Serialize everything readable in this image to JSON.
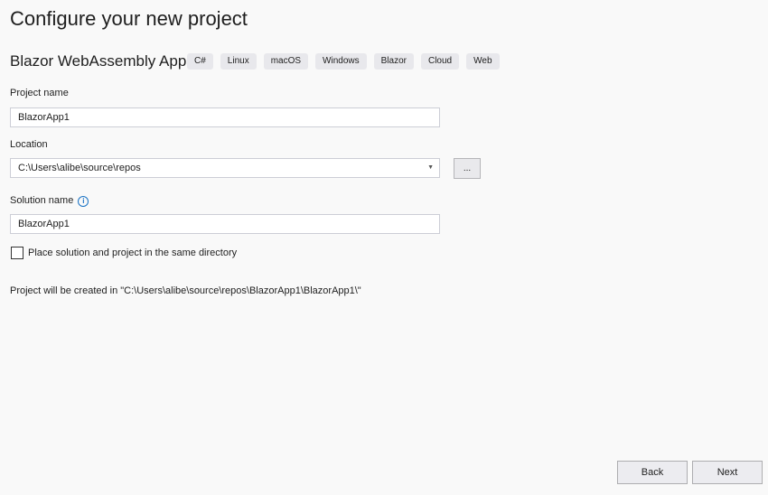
{
  "title": "Configure your new project",
  "template": {
    "name": "Blazor WebAssembly App",
    "tags": [
      "C#",
      "Linux",
      "macOS",
      "Windows",
      "Blazor",
      "Cloud",
      "Web"
    ]
  },
  "project_name": {
    "label": "Project name",
    "value": "BlazorApp1"
  },
  "location": {
    "label": "Location",
    "value": "C:\\Users\\alibe\\source\\repos",
    "browse_label": "..."
  },
  "solution_name": {
    "label": "Solution name",
    "value": "BlazorApp1",
    "info": "i"
  },
  "same_dir": {
    "label": "Place solution and project in the same directory",
    "checked": false
  },
  "summary": "Project will be created in \"C:\\Users\\alibe\\source\\repos\\BlazorApp1\\BlazorApp1\\\"",
  "buttons": {
    "back": "Back",
    "next": "Next"
  }
}
